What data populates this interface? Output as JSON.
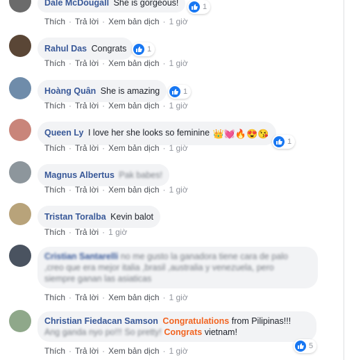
{
  "actions": {
    "like": "Thích",
    "reply": "Trả lời",
    "translate": "Xem bản dịch",
    "sep": "·"
  },
  "comments": [
    {
      "author": "Dale McDougall",
      "text": "She is gorgeous!",
      "reaction_count": "1",
      "time": "1 giờ",
      "avatar_color": "#6b6b6b"
    },
    {
      "author": "Rahul Das",
      "text": "Congrats",
      "reaction_count": "1",
      "time": "1 giờ",
      "avatar_color": "#5a4636"
    },
    {
      "author": "Hoàng Quân",
      "text": "She is amazing",
      "reaction_count": "1",
      "time": "1 giờ",
      "avatar_color": "#6f8caa"
    },
    {
      "author": "Queen Ly",
      "text": "I love her she looks so feminine",
      "emojis": "👑💓🔥😍😘",
      "reaction_count": "1",
      "time": "1 giờ",
      "avatar_color": "#c9857a"
    },
    {
      "author": "Magnus Albertus",
      "text": "Pak babes!",
      "time": "1 giờ",
      "avatar_color": "#8d969c"
    },
    {
      "author": "Tristan Toralba",
      "text": "Kevin balot",
      "time": "1 giờ",
      "avatar_color": "#b8a37a"
    },
    {
      "author": "Cristian Santarelli",
      "text_lines": [
        "no me gusto la ganadora tiene cara de palo",
        ",creo que era mejor italia ,brasil ,australia y venezuela, pero",
        "siempre ganan las asiaticas"
      ],
      "time": "1 giờ",
      "avatar_color": "#4a5360"
    },
    {
      "author": "Christian Fiedacan Samson",
      "hl1": "Congratulations",
      "mid": " from Pilipinas!!!",
      "line2a": "Ang ganda nyo po!!! So pretty! ",
      "hl2": "Congrats",
      "line2b": " vietnam!",
      "reaction_count": "5",
      "time": "1 giờ",
      "avatar_color": "#8fa88a"
    }
  ]
}
